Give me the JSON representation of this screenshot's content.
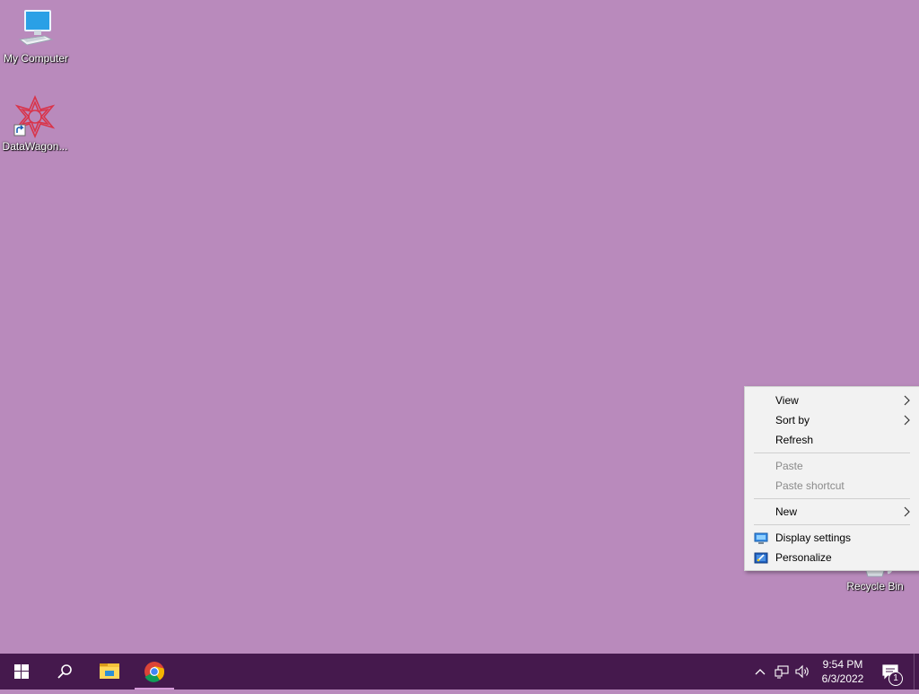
{
  "desktop": {
    "background_color": "#b98abc",
    "icons": [
      {
        "label": "My Computer",
        "icon": "computer-icon"
      },
      {
        "label": "DataWagon...",
        "icon": "datawagon-shortcut-icon"
      },
      {
        "label": "Recycle Bin",
        "icon": "recycle-bin-icon"
      }
    ]
  },
  "context_menu": {
    "items": [
      {
        "label": "View",
        "submenu": true,
        "enabled": true
      },
      {
        "label": "Sort by",
        "submenu": true,
        "enabled": true
      },
      {
        "label": "Refresh",
        "submenu": false,
        "enabled": true
      },
      {
        "label": "Paste",
        "submenu": false,
        "enabled": false
      },
      {
        "label": "Paste shortcut",
        "submenu": false,
        "enabled": false
      },
      {
        "label": "New",
        "submenu": true,
        "enabled": true
      },
      {
        "label": "Display settings",
        "submenu": false,
        "enabled": true,
        "icon": "display-settings-icon"
      },
      {
        "label": "Personalize",
        "submenu": false,
        "enabled": true,
        "icon": "personalize-icon"
      }
    ]
  },
  "taskbar": {
    "color": "#45194d",
    "buttons": [
      "start-windows-icon",
      "search-icon",
      "file-explorer-icon",
      "chrome-icon"
    ],
    "tray": {
      "icons": [
        "show-hidden-icons-chevron-icon",
        "network-icon",
        "volume-icon"
      ],
      "time": "9:54 PM",
      "date": "6/3/2022",
      "notification_count": "1"
    }
  }
}
